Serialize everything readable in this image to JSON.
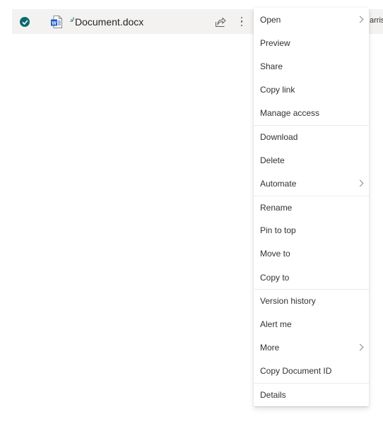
{
  "file_row": {
    "file_name": "Document.docx",
    "author_fragment": "arris",
    "selected": true,
    "is_new": true,
    "file_type_icon": "word-doc-icon",
    "colors": {
      "check_fill": "#0b6a6e",
      "new_indicator": "#0b6a6e",
      "word_blue": "#185abd",
      "row_background": "#f3f2f1"
    }
  },
  "context_menu": {
    "items": [
      {
        "label": "Open",
        "submenu": true,
        "separator_before": false
      },
      {
        "label": "Preview",
        "submenu": false,
        "separator_before": false
      },
      {
        "label": "Share",
        "submenu": false,
        "separator_before": false
      },
      {
        "label": "Copy link",
        "submenu": false,
        "separator_before": false
      },
      {
        "label": "Manage access",
        "submenu": false,
        "separator_before": false
      },
      {
        "label": "Download",
        "submenu": false,
        "separator_before": true
      },
      {
        "label": "Delete",
        "submenu": false,
        "separator_before": false
      },
      {
        "label": "Automate",
        "submenu": true,
        "separator_before": false
      },
      {
        "label": "Rename",
        "submenu": false,
        "separator_before": true
      },
      {
        "label": "Pin to top",
        "submenu": false,
        "separator_before": false
      },
      {
        "label": "Move to",
        "submenu": false,
        "separator_before": false
      },
      {
        "label": "Copy to",
        "submenu": false,
        "separator_before": false
      },
      {
        "label": "Version history",
        "submenu": false,
        "separator_before": true
      },
      {
        "label": "Alert me",
        "submenu": false,
        "separator_before": false
      },
      {
        "label": "More",
        "submenu": true,
        "separator_before": false
      },
      {
        "label": "Copy Document ID",
        "submenu": false,
        "separator_before": false
      },
      {
        "label": "Details",
        "submenu": false,
        "separator_before": true
      }
    ]
  }
}
